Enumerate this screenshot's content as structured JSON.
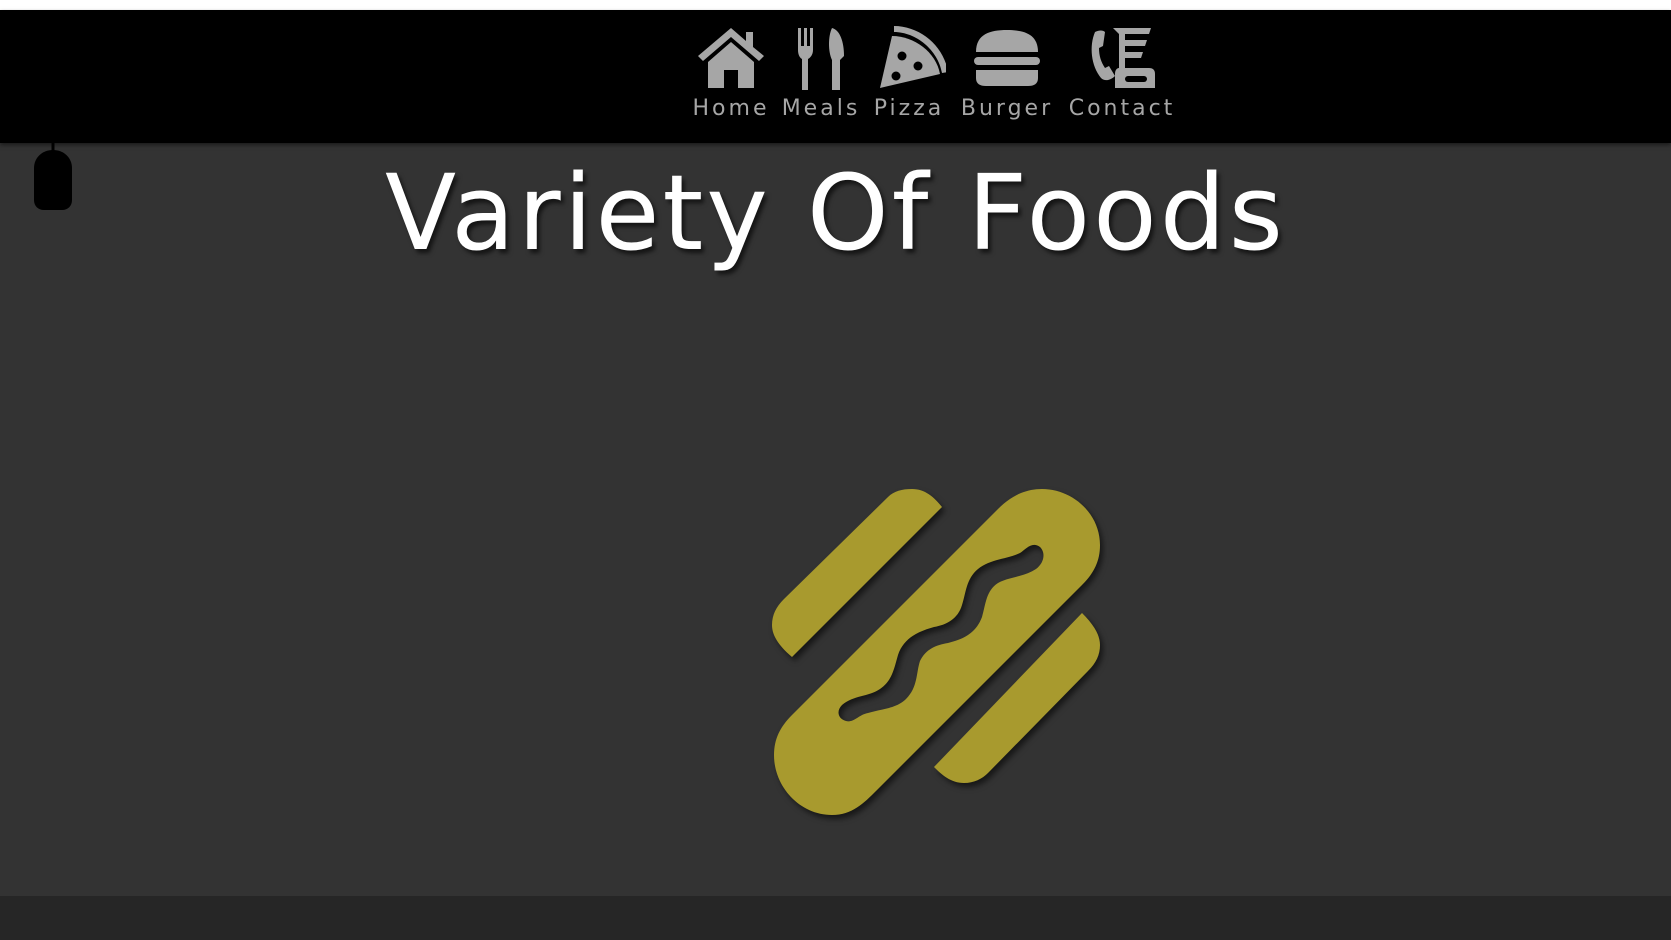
{
  "nav": {
    "items": [
      {
        "label": "Home",
        "icon": "home-icon"
      },
      {
        "label": "Meals",
        "icon": "utensils-icon"
      },
      {
        "label": "Pizza",
        "icon": "pizza-slice-icon"
      },
      {
        "label": "Burger",
        "icon": "burger-icon"
      },
      {
        "label": "Contact",
        "icon": "phone-fax-icon"
      }
    ],
    "color": "#a6a6a6"
  },
  "hero": {
    "title": "Variety Of Foods",
    "icon": "hotdog-icon",
    "icon_color": "#a89a2e"
  },
  "scroll_indicator": {
    "icon": "mouse-icon"
  },
  "colors": {
    "navbar_bg": "#000000",
    "page_bg": "#333333",
    "footer_bg": "#262626",
    "title": "#ffffff"
  }
}
